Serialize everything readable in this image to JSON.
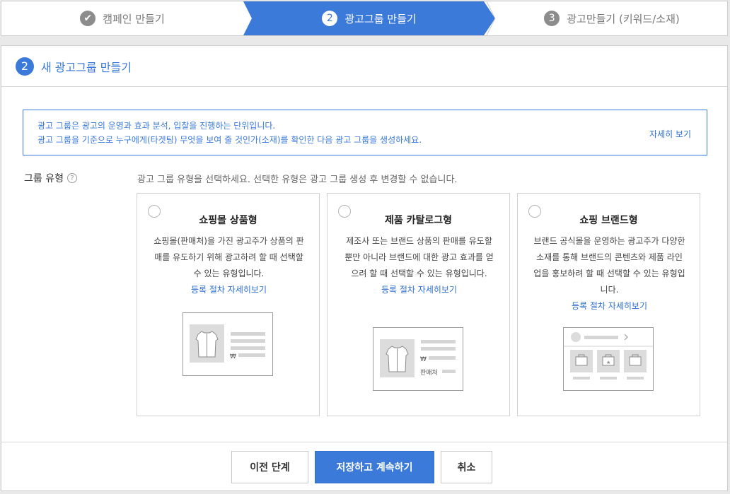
{
  "stepper": {
    "steps": [
      {
        "num": "✔",
        "label": "캠페인 만들기",
        "state": "done"
      },
      {
        "num": "2",
        "label": "광고그룹 만들기",
        "state": "active"
      },
      {
        "num": "3",
        "label": "광고만들기 (키워드/소재)",
        "state": "pending"
      }
    ],
    "active_color": "#3b7ad9"
  },
  "header": {
    "num": "2",
    "title": "새 광고그룹 만들기"
  },
  "info": {
    "line1": "광고 그룹은 광고의 운영과 효과 분석, 입찰을 진행하는 단위입니다.",
    "line2": "광고 그룹을 기준으로 누구에게(타겟팅) 무엇을 보여 줄 것인가(소재)를 확인한 다음 광고 그룹을 생성하세요.",
    "link": "자세히 보기"
  },
  "group_type": {
    "label": "그룹 유형",
    "help": "?",
    "description": "광고 그룹 유형을 선택하세요. 선택한 유형은 광고 그룹 생성 후 변경할 수 없습니다."
  },
  "cards": [
    {
      "title": "쇼핑몰 상품형",
      "desc": "쇼핑몰(판매처)을 가진 광고주가 상품의 판매를 유도하기 위해 광고하려 할 때 선택할 수 있는 유형입니다.",
      "link": "등록 절차 자세히보기",
      "selected": false,
      "price_symbol": "₩"
    },
    {
      "title": "제품 카탈로그형",
      "desc": "제조사 또는 브랜드 상품의 판매를 유도할 뿐만 아니라 브랜드에 대한 광고 효과를 얻으려 할 때 선택할 수 있는 유형입니다.",
      "link": "등록 절차 자세히보기",
      "selected": false,
      "price_symbol": "₩",
      "seller_label": "판매처"
    },
    {
      "title": "쇼핑 브랜드형",
      "desc": "브랜드 공식몰을 운영하는 광고주가 다양한 소재를 통해 브랜드의 콘텐츠와 제품 라인업을 홍보하려 할 때 선택할 수 있는 유형입니다.",
      "link": "등록 절차 자세히보기",
      "selected": false
    }
  ],
  "footer": {
    "prev": "이전 단계",
    "save": "저장하고 계속하기",
    "cancel": "취소"
  }
}
